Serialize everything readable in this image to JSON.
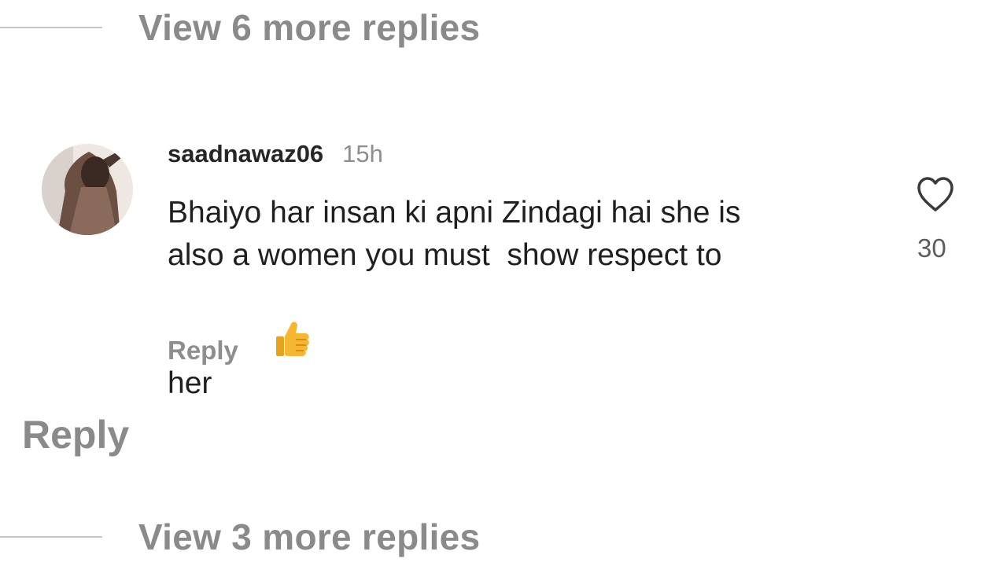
{
  "thread": {
    "view_more_top": "View 6 more replies",
    "view_more_bottom": "View 3 more replies",
    "reply_label": "Reply"
  },
  "comment": {
    "username": "saadnawaz06",
    "timestamp": "15h",
    "text_lines": [
      "Bhaiyo har insan ki apni Zindagi hai she is",
      "also a women you must  show respect to",
      "her"
    ],
    "emoji": "thumbs-up-emoji",
    "like_icon": "heart-outline-icon",
    "like_count": "30",
    "reply_label": "Reply"
  }
}
